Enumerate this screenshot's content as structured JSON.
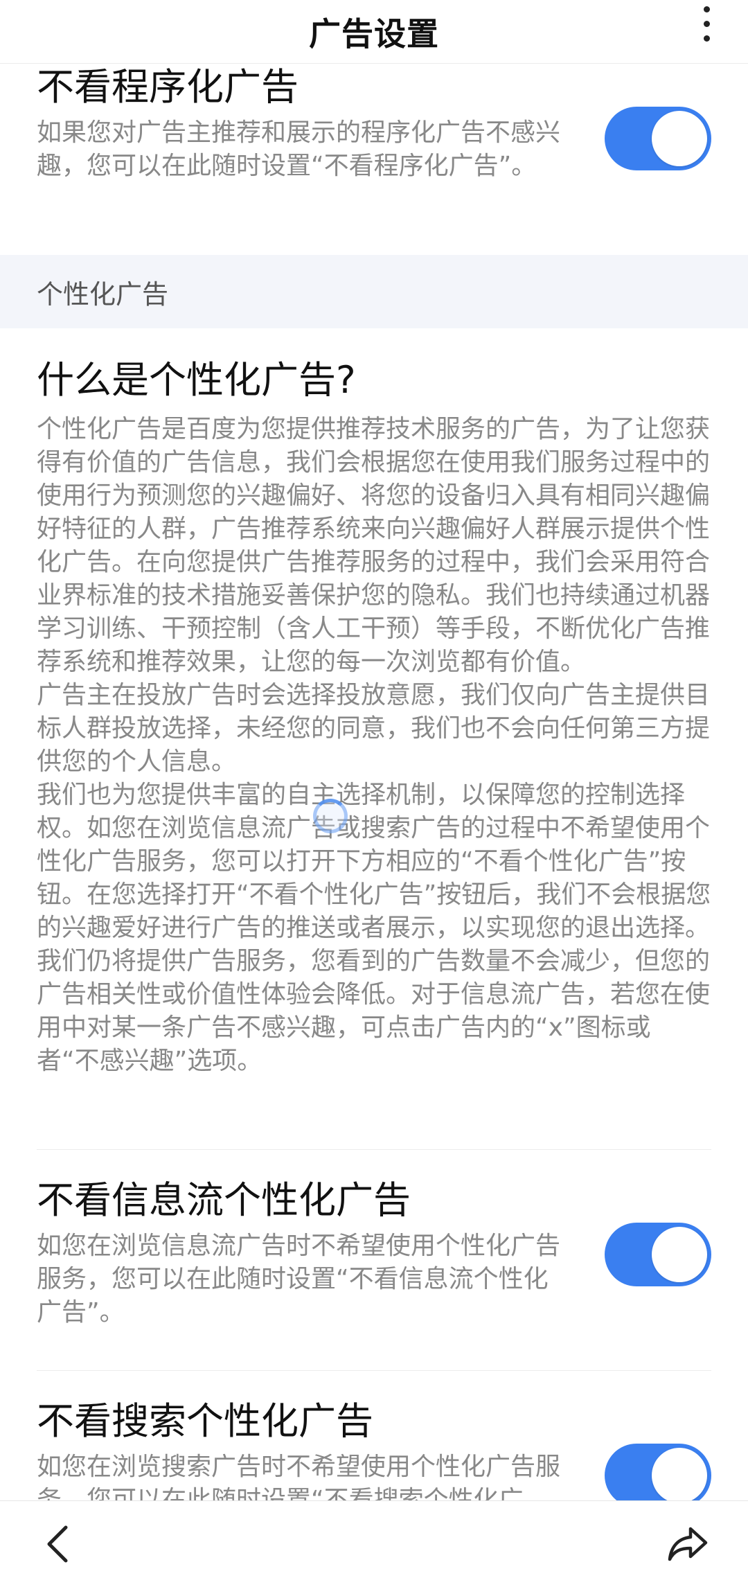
{
  "header": {
    "title": "广告设置"
  },
  "programmatic": {
    "title": "不看程序化广告",
    "desc": "如果您对广告主推荐和展示的程序化广告不感兴趣，您可以在此随时设置“不看程序化广告”。",
    "enabled": true
  },
  "section": {
    "label": "个性化广告"
  },
  "info": {
    "title": "什么是个性化广告?",
    "paragraphs": [
      "个性化广告是百度为您提供推荐技术服务的广告，为了让您获得有价值的广告信息，我们会根据您在使用我们服务过程中的使用行为预测您的兴趣偏好、将您的设备归入具有相同兴趣偏好特征的人群，广告推荐系统来向兴趣偏好人群展示提供个性化广告。在向您提供广告推荐服务的过程中，我们会采用符合业界标准的技术措施妥善保护您的隐私。我们也持续通过机器学习训练、干预控制（含人工干预）等手段，不断优化广告推荐系统和推荐效果，让您的每一次浏览都有价值。",
      "广告主在投放广告时会选择投放意愿，我们仅向广告主提供目标人群投放选择，未经您的同意，我们也不会向任何第三方提供您的个人信息。",
      "我们也为您提供丰富的自主选择机制，以保障您的控制选择权。如您在浏览信息流广告或搜索广告的过程中不希望使用个性化广告服务，您可以打开下方相应的“不看个性化广告”按钮。在您选择打开“不看个性化广告”按钮后，我们不会根据您的兴趣爱好进行广告的推送或者展示，以实现您的退出选择。我们仍将提供广告服务，您看到的广告数量不会减少，但您的广告相关性或价值性体验会降低。对于信息流广告，若您在使用中对某一条广告不感兴趣，可点击广告内的“x”图标或者“不感兴趣”选项。"
    ]
  },
  "feed": {
    "title": "不看信息流个性化广告",
    "desc": "如您在浏览信息流广告时不希望使用个性化广告服务，您可以在此随时设置“不看信息流个性化广告”。",
    "enabled": true
  },
  "search": {
    "title": "不看搜索个性化广告",
    "desc": "如您在浏览搜索广告时不希望使用个性化广告服务，您可以在此随时设置“不看搜索个性化广告”。",
    "enabled": true
  },
  "icons": {
    "more": "more-vertical-icon",
    "back": "chevron-left-icon",
    "share": "share-icon",
    "loading": "loading-spinner-icon"
  },
  "colors": {
    "accent": "#3a7ff0",
    "section_bg": "#f3f5fa",
    "desc_text": "#888888"
  }
}
